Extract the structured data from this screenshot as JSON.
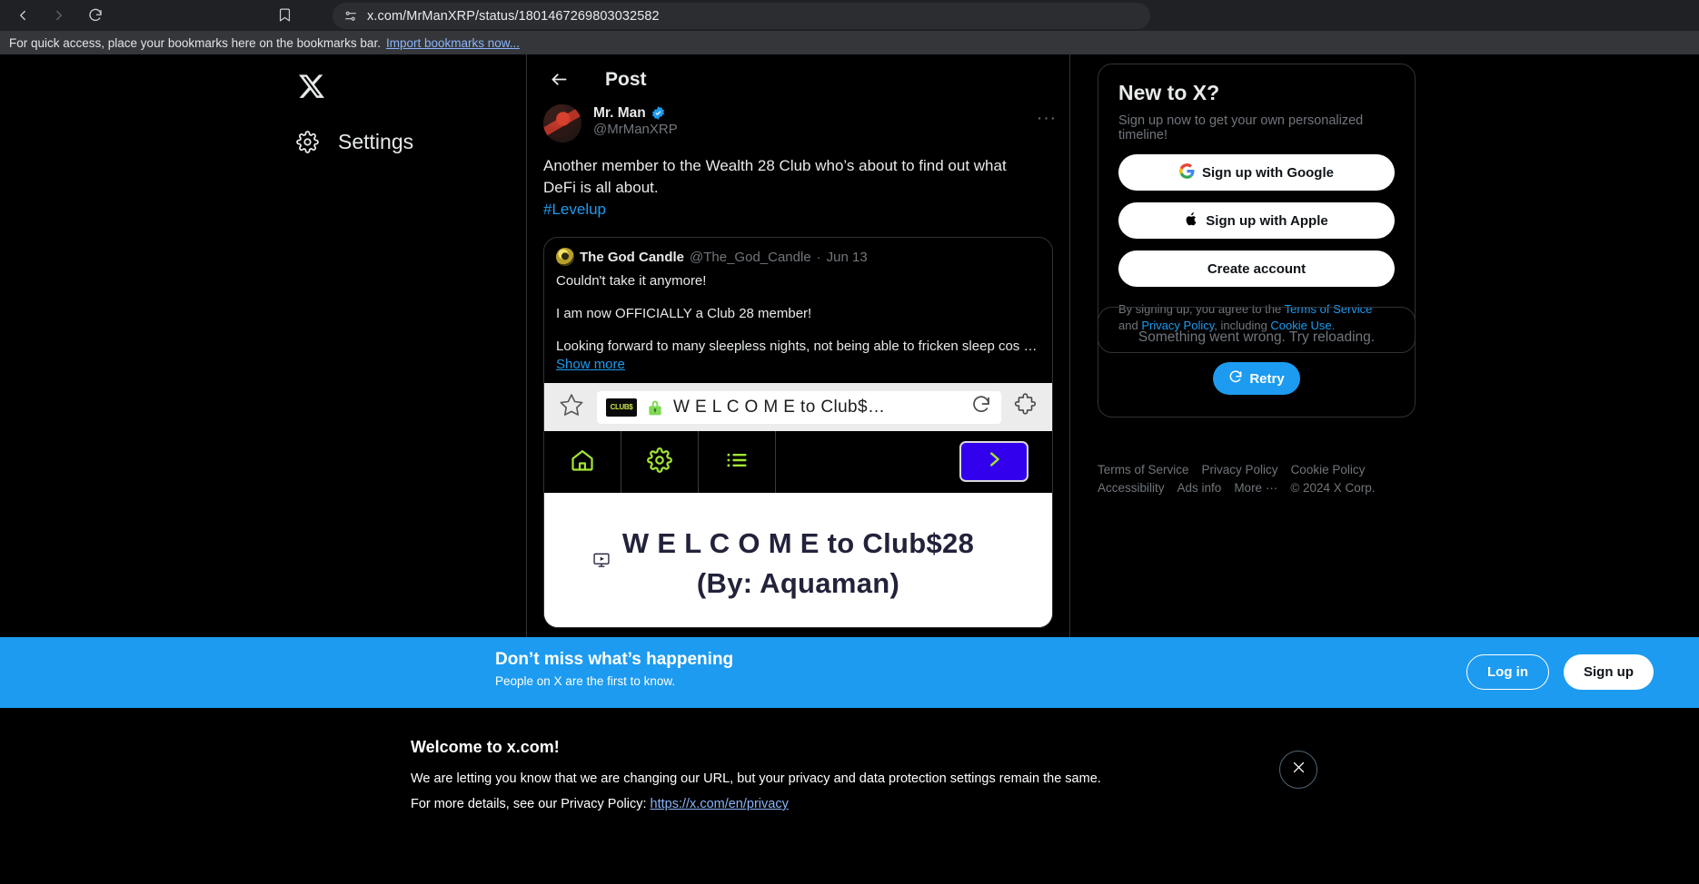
{
  "browser": {
    "url": "x.com/MrManXRP/status/1801467269803032582",
    "back_icon": "back-arrow-icon",
    "forward_icon": "forward-arrow-icon",
    "reload_icon": "reload-icon",
    "bookmark_icon": "bookmark-icon",
    "site_settings_icon": "site-settings-icon",
    "bookmarks_bar": {
      "message": "For quick access, place your bookmarks here on the bookmarks bar.",
      "link": "Import bookmarks now..."
    }
  },
  "left_nav": {
    "logo": "x-logo",
    "items": [
      {
        "label": "Settings",
        "icon": "gear-icon"
      }
    ]
  },
  "post": {
    "header_title": "Post",
    "back_label": "back-arrow-icon",
    "author": {
      "display_name": "Mr. Man",
      "handle": "@MrManXRP",
      "verified": true
    },
    "more_label": "···",
    "text_line1": "Another member to the Wealth 28 Club who’s about to find out what",
    "text_line2": "DeFi is all about.",
    "hashtag": "#Levelup",
    "quote": {
      "display_name": "The God Candle",
      "handle": "@The_God_Candle",
      "separator": "·",
      "date": "Jun 13",
      "line1": "Couldn't take it anymore!",
      "line2": "I am now OFFICIALLY a Club 28 member!",
      "line3": "Looking forward to many sleepless nights, not being able to fricken sleep cos …",
      "show_more": "Show more",
      "embed": {
        "star_icon": "star-icon",
        "site_chip_text": "CLUB$",
        "lock_icon": "lock-icon",
        "page_title": "W E L C O M E to Club$…",
        "reload_icon": "reload-icon",
        "extensions_icon": "puzzle-piece-icon",
        "nav_icons": [
          "home-icon",
          "gear-icon",
          "list-icon"
        ],
        "go_button_icon": "chevron-right-icon",
        "go_button_color": "#3300ee",
        "accent_color": "#a3e635",
        "hero_line1": "W E L C O M E to Club$28",
        "hero_line2": "(By: Aquaman)",
        "hero_icon": "video-screen-icon"
      }
    }
  },
  "sidebar": {
    "signup": {
      "title": "New to X?",
      "subtitle": "Sign up now to get your own personalized timeline!",
      "google_button": "Sign up with Google",
      "apple_button": "Sign up with Apple",
      "create_button": "Create account",
      "legal_prefix": "By signing up, you agree to the ",
      "terms": "Terms of Service",
      "legal_and": " and ",
      "privacy": "Privacy Policy",
      "legal_including": ", including ",
      "cookie": "Cookie Use",
      "legal_end": "."
    },
    "error": {
      "message": "Something went wrong. Try reloading.",
      "retry_label": "Retry",
      "retry_icon": "reload-icon",
      "retry_color": "#1d9bf0"
    },
    "footer": [
      "Terms of Service",
      "Privacy Policy",
      "Cookie Policy",
      "Accessibility",
      "Ads info",
      "More ···",
      "© 2024 X Corp."
    ]
  },
  "banner": {
    "heading": "Don’t miss what’s happening",
    "sub": "People on X are the first to know.",
    "login": "Log in",
    "signup": "Sign up",
    "color": "#1d9bf0"
  },
  "notice": {
    "heading": "Welcome to x.com!",
    "line1": "We are letting you know that we are changing our URL, but your privacy and data protection settings remain the same.",
    "line2_prefix": "For more details, see our Privacy Policy: ",
    "line2_link": "https://x.com/en/privacy",
    "close_icon": "close-icon"
  }
}
